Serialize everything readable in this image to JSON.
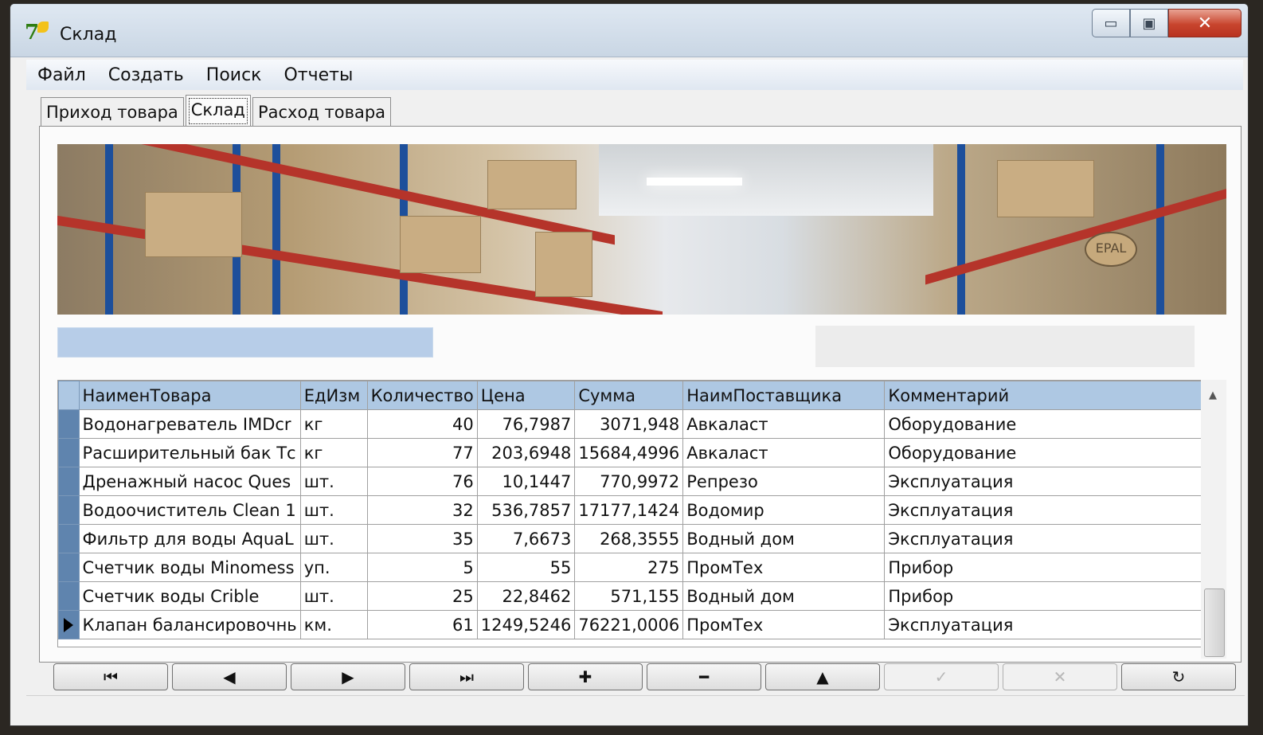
{
  "window": {
    "title": "Склад"
  },
  "menu": [
    "Файл",
    "Создать",
    "Поиск",
    "Отчеты"
  ],
  "tabs": [
    "Приход товара",
    "Склад",
    "Расход товара"
  ],
  "active_tab": "Склад",
  "banner": {
    "sign_text": "EPAL"
  },
  "grid": {
    "columns": [
      "НаименТовара",
      "ЕдИзм",
      "Количество",
      "Цена",
      "Сумма",
      "НаимПоставщика",
      "Комментарий"
    ],
    "rows": [
      [
        "Водонагреватель IMDcr",
        "кг",
        "40",
        "76,7987",
        "3071,948",
        "Авкаласт",
        "Оборудование"
      ],
      [
        "Расширительный бак Тс",
        "кг",
        "77",
        "203,6948",
        "15684,4996",
        "Авкаласт",
        "Оборудование"
      ],
      [
        "Дренажный насос Ques",
        "шт.",
        "76",
        "10,1447",
        "770,9972",
        "Репрезо",
        "Эксплуатация"
      ],
      [
        "Водоочиститель Clean 1",
        "шт.",
        "32",
        "536,7857",
        "17177,1424",
        "Водомир",
        "Эксплуатация"
      ],
      [
        "Фильтр для воды AquaL",
        "шт.",
        "35",
        "7,6673",
        "268,3555",
        "Водный дом",
        "Эксплуатация"
      ],
      [
        "Счетчик воды Minomess",
        "уп.",
        "5",
        "55",
        "275",
        "ПромТех",
        "Прибор"
      ],
      [
        "Счетчик воды Crible",
        "шт.",
        "25",
        "22,8462",
        "571,155",
        "Водный дом",
        "Прибор"
      ],
      [
        "Клапан балансировочнь",
        "км.",
        "61",
        "1249,5246",
        "76221,0006",
        "ПромТех",
        "Эксплуатация"
      ]
    ],
    "current_row": 7
  },
  "navigator": [
    {
      "name": "nav-first-button",
      "glyph": "⏮",
      "enabled": true
    },
    {
      "name": "nav-prior-button",
      "glyph": "◀",
      "enabled": true
    },
    {
      "name": "nav-next-button",
      "glyph": "▶",
      "enabled": true
    },
    {
      "name": "nav-last-button",
      "glyph": "⏭",
      "enabled": true
    },
    {
      "name": "nav-insert-button",
      "glyph": "✚",
      "enabled": true
    },
    {
      "name": "nav-delete-button",
      "glyph": "━",
      "enabled": true
    },
    {
      "name": "nav-edit-button",
      "glyph": "▲",
      "enabled": true
    },
    {
      "name": "nav-post-button",
      "glyph": "✓",
      "enabled": false
    },
    {
      "name": "nav-cancel-button",
      "glyph": "✕",
      "enabled": false
    },
    {
      "name": "nav-refresh-button",
      "glyph": "↻",
      "enabled": true
    }
  ]
}
